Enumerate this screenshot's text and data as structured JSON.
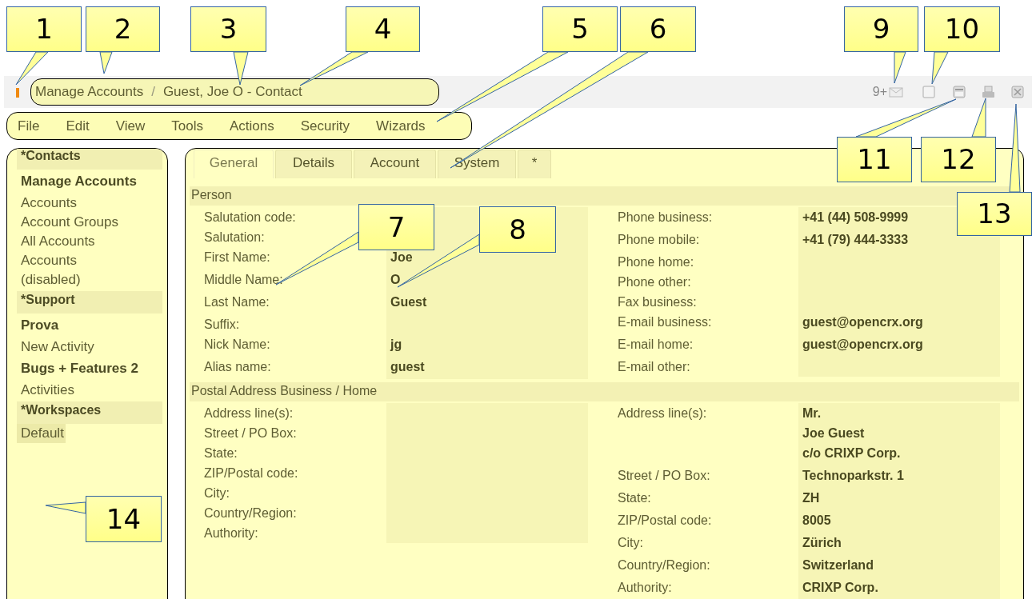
{
  "breadcrumb": [
    "Manage Accounts",
    "Guest, Joe O - Contact"
  ],
  "breadcrumb_separator": "/",
  "notification_count": "9+",
  "menu": [
    "File",
    "Edit",
    "View",
    "Tools",
    "Actions",
    "Security",
    "Wizards"
  ],
  "sidebar": {
    "groups": [
      {
        "title": "*Contacts",
        "items": [
          {
            "label": "Manage Accounts",
            "kind": "folder",
            "selected": false
          },
          {
            "label": "Accounts",
            "kind": "link",
            "selected": false
          },
          {
            "label": "Account Groups",
            "kind": "link",
            "selected": false
          },
          {
            "label": "All Accounts",
            "kind": "link",
            "selected": false
          },
          {
            "label": "Accounts (disabled)",
            "kind": "link",
            "selected": false
          }
        ]
      },
      {
        "title": "*Support",
        "items": [
          {
            "label": "Prova",
            "kind": "folder",
            "selected": false
          },
          {
            "label": "New Activity",
            "kind": "link",
            "selected": false
          },
          {
            "label": "Bugs + Features 2",
            "kind": "folder",
            "selected": false
          },
          {
            "label": "Activities",
            "kind": "link",
            "selected": false
          }
        ]
      },
      {
        "title": "*Workspaces",
        "items": [
          {
            "label": "Default",
            "kind": "link",
            "selected": true
          }
        ]
      }
    ]
  },
  "tabs": [
    {
      "label": "General",
      "selected": true
    },
    {
      "label": "Details",
      "selected": false
    },
    {
      "label": "Account",
      "selected": false
    },
    {
      "label": "System",
      "selected": false
    },
    {
      "label": "*",
      "selected": false
    }
  ],
  "sections": [
    {
      "title": "Person",
      "left": [
        {
          "label": "Salutation code:"
        },
        {
          "label": "Salutation:"
        },
        {
          "label": "First Name:",
          "lines": [
            "Joe"
          ]
        },
        {
          "label": "Middle Name:",
          "lines": [
            "O"
          ]
        },
        {
          "label": "Last Name:",
          "lines": [
            "Guest"
          ]
        },
        {
          "label": "Suffix:"
        },
        {
          "label": "Nick Name:",
          "lines": [
            "jg"
          ]
        },
        {
          "label": "Alias name:",
          "lines": [
            "guest"
          ]
        }
      ],
      "right": [
        {
          "label": "Phone business:",
          "lines": [
            "+41 (44) 508-9999"
          ]
        },
        {
          "label": "Phone mobile:",
          "lines": [
            "+41 (79) 444-3333"
          ]
        },
        {
          "label": "Phone home:"
        },
        {
          "label": "Phone other:"
        },
        {
          "label": "Fax business:"
        },
        {
          "label": "E-mail business:",
          "lines": [
            "guest@opencrx.org"
          ]
        },
        {
          "label": "E-mail home:",
          "lines": [
            "guest@opencrx.org"
          ]
        },
        {
          "label": "E-mail other:"
        }
      ]
    },
    {
      "title": "Postal Address Business / Home",
      "left": [
        {
          "label": "Address line(s):"
        },
        {
          "label": "Street / PO Box:"
        },
        {
          "label": "State:"
        },
        {
          "label": "ZIP/Postal code:"
        },
        {
          "label": "City:"
        },
        {
          "label": "Country/Region:"
        },
        {
          "label": "Authority:"
        }
      ],
      "right": [
        {
          "label": "Address line(s):",
          "lines": [
            "Mr.",
            "Joe Guest",
            "c/o CRIXP Corp."
          ]
        },
        {
          "label": "Street / PO Box:",
          "lines": [
            "Technoparkstr. 1"
          ]
        },
        {
          "label": "State:",
          "lines": [
            "ZH"
          ]
        },
        {
          "label": "ZIP/Postal code:",
          "lines": [
            "8005"
          ]
        },
        {
          "label": "City:",
          "lines": [
            "Zürich"
          ]
        },
        {
          "label": "Country/Region:",
          "lines": [
            "Switzerland"
          ]
        },
        {
          "label": "Authority:",
          "lines": [
            "CRIXP Corp."
          ]
        }
      ]
    }
  ],
  "callouts": [
    "1",
    "2",
    "3",
    "4",
    "5",
    "6",
    "7",
    "8",
    "9",
    "10",
    "11",
    "12",
    "13",
    "14"
  ]
}
